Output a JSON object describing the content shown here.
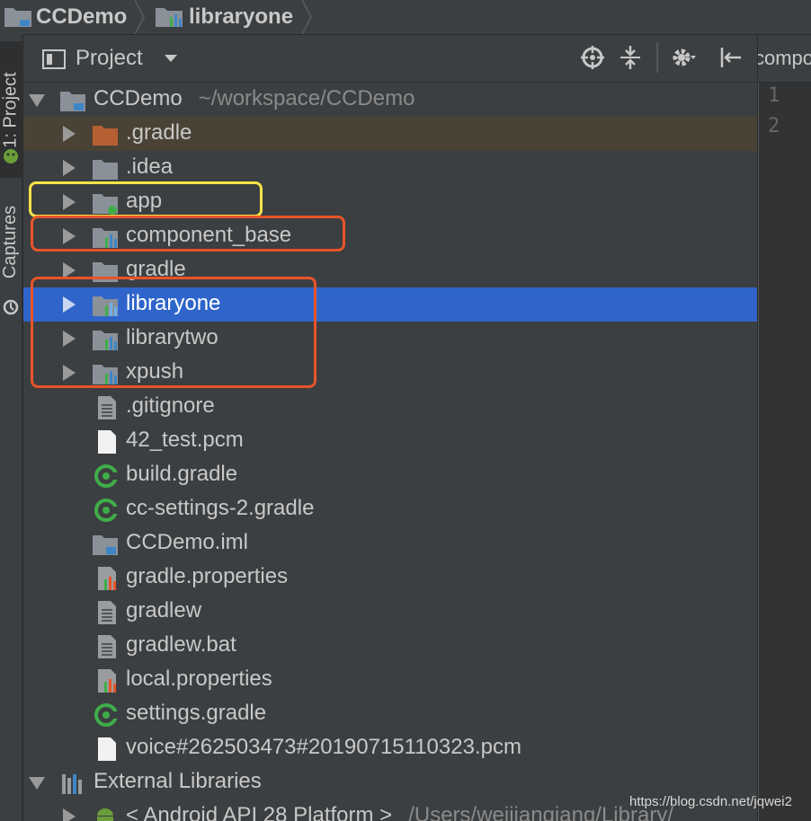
{
  "breadcrumbs": [
    "CCDemo",
    "libraryone"
  ],
  "sidebar_tabs": [
    "1: Project",
    "Captures"
  ],
  "panel": {
    "title": "Project"
  },
  "editor": {
    "tab_label": "compon",
    "line_numbers": [
      "1",
      "2"
    ]
  },
  "tree": {
    "root": {
      "name": "CCDemo",
      "path": "~/workspace/CCDemo"
    },
    "folders": [
      ".gradle",
      ".idea",
      "app",
      "component_base",
      "gradle",
      "libraryone",
      "librarytwo",
      "xpush"
    ],
    "files": [
      ".gitignore",
      "42_test.pcm",
      "build.gradle",
      "cc-settings-2.gradle",
      "CCDemo.iml",
      "gradle.properties",
      "gradlew",
      "gradlew.bat",
      "local.properties",
      "settings.gradle",
      "voice#262503473#20190715110323.pcm"
    ],
    "external": {
      "name": "External Libraries",
      "sdk": "< Android API 28 Platform >",
      "sdk_path": "/Users/weijiangiang/Library/"
    }
  },
  "colors": {
    "selection": "#2f65ca",
    "yellow_frame": "#f5e34a",
    "orange_frame": "#e8542a",
    "accent_green": "#3fae49"
  },
  "watermark": "https://blog.csdn.net/jqwei2"
}
